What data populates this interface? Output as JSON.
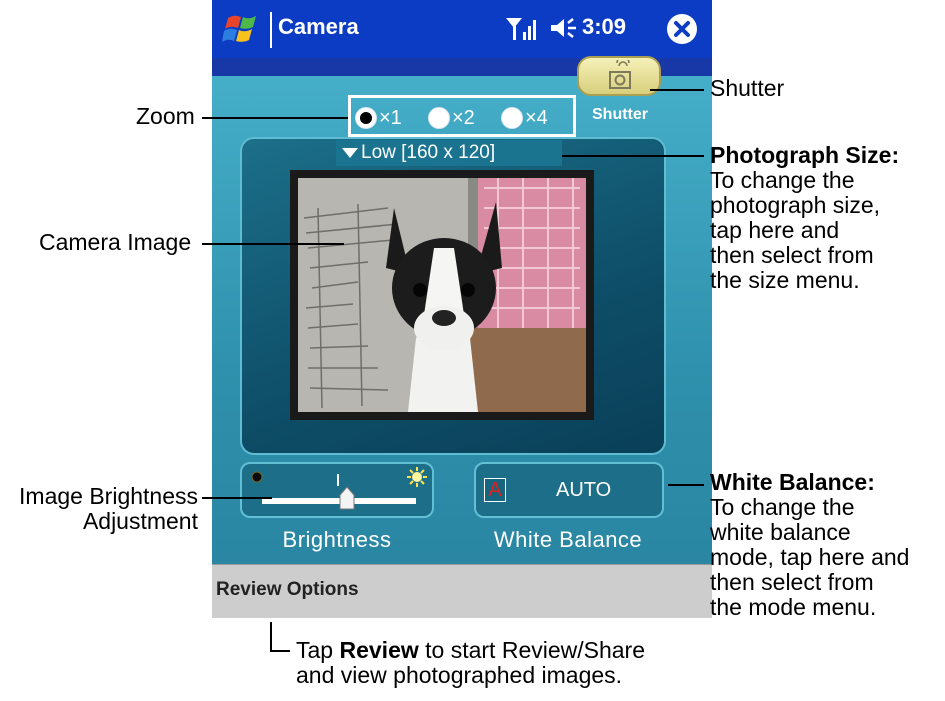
{
  "titlebar": {
    "app_title": "Camera",
    "time": "3:09"
  },
  "camera": {
    "zoom_options": [
      "×1",
      "×2",
      "×4"
    ],
    "zoom_selected": "×1",
    "shutter_label": "Shutter",
    "photo_size": "Low [160 x 120]",
    "brightness_label": "Brightness",
    "brightness_level": 0.55,
    "white_balance_icon": "A",
    "white_balance_value": "AUTO",
    "white_balance_label": "White Balance"
  },
  "menubar": {
    "review_options": "Review Options"
  },
  "callouts": {
    "shutter": "Shutter",
    "zoom": "Zoom",
    "camera_image": "Camera Image",
    "brightness_line1": "Image Brightness",
    "brightness_line2": "Adjustment",
    "photo_size_title": "Photograph Size:",
    "photo_size_desc": [
      "To change the",
      "photograph size,",
      "tap here and",
      "then select from",
      "the size menu."
    ],
    "wb_title": "White Balance:",
    "wb_desc": [
      "To change the",
      "white balance",
      "mode, tap here and",
      "then select from",
      "the mode menu."
    ],
    "review_tap": "Tap",
    "review_bold": "Review",
    "review_rest": "to start Review/Share",
    "review_line2": "and view photographed images."
  },
  "colors": {
    "titlebar": "#0d3cc4",
    "panel": "#2d8fa8",
    "menubar": "#cdcdcd",
    "shutter": "#e8df94"
  }
}
